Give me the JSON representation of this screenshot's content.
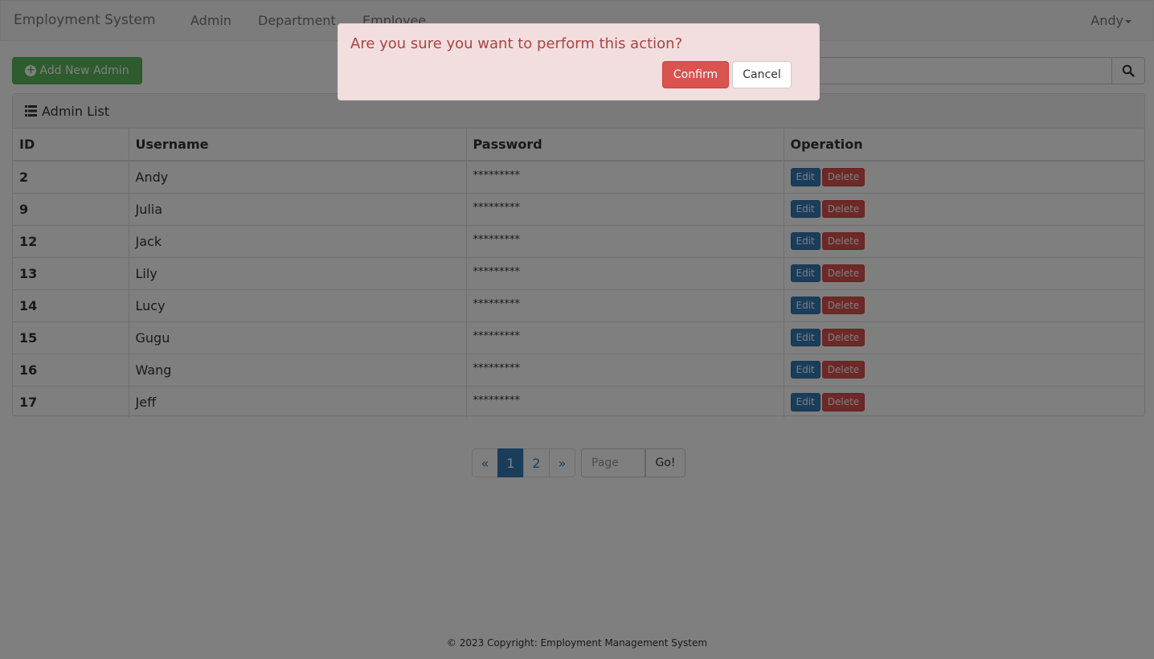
{
  "navbar": {
    "brand": "Employment System",
    "links": [
      "Admin",
      "Department",
      "Employee"
    ],
    "user": "Andy"
  },
  "toolbar": {
    "add_label": "Add New Admin",
    "search_icon": "search-icon"
  },
  "panel": {
    "title": "Admin List",
    "columns": [
      "ID",
      "Username",
      "Password",
      "Operation"
    ],
    "edit_label": "Edit",
    "delete_label": "Delete",
    "rows": [
      {
        "id": "2",
        "username": "Andy",
        "password": "*********"
      },
      {
        "id": "9",
        "username": "Julia",
        "password": "*********"
      },
      {
        "id": "12",
        "username": "Jack",
        "password": "*********"
      },
      {
        "id": "13",
        "username": "Lily",
        "password": "*********"
      },
      {
        "id": "14",
        "username": "Lucy",
        "password": "*********"
      },
      {
        "id": "15",
        "username": "Gugu",
        "password": "*********"
      },
      {
        "id": "16",
        "username": "Wang",
        "password": "*********"
      },
      {
        "id": "17",
        "username": "Jeff",
        "password": "*********"
      }
    ]
  },
  "pagination": {
    "prev": "«",
    "pages": [
      "1",
      "2"
    ],
    "active_page": "1",
    "next": "»",
    "page_placeholder": "Page",
    "go_label": "Go!"
  },
  "footer": {
    "text": "© 2023 Copyright: Employment Management System"
  },
  "dialog": {
    "message": "Are you sure you want to perform this action?",
    "confirm_label": "Confirm",
    "cancel_label": "Cancel"
  },
  "colors": {
    "primary": "#337ab7",
    "success": "#5cb85c",
    "danger": "#d9534f",
    "alert_bg": "#f2dede",
    "alert_text": "#a94442"
  }
}
